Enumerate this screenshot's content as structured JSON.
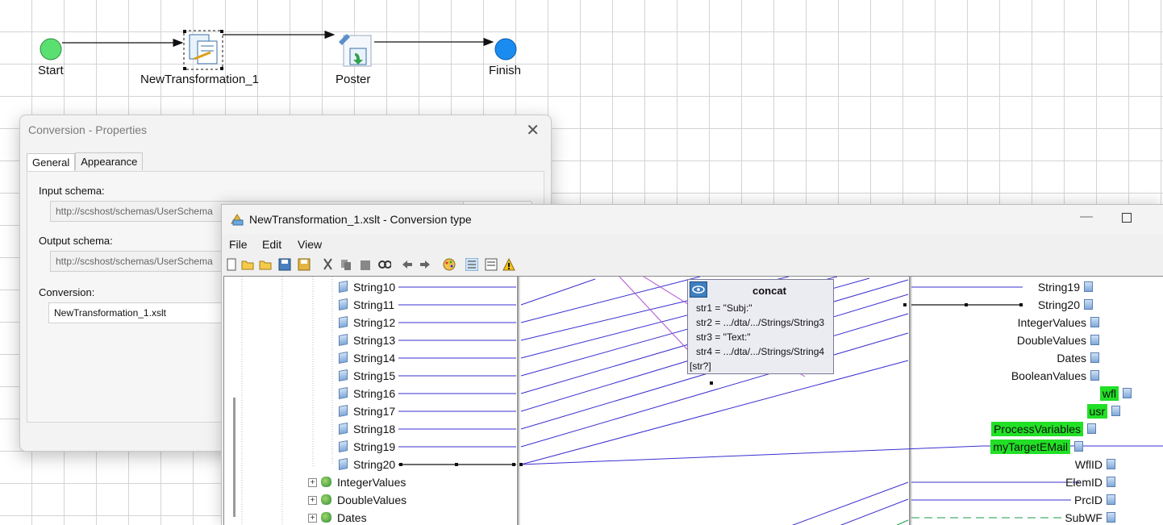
{
  "workflow": {
    "nodes": [
      {
        "label": "Start"
      },
      {
        "label": "NewTransformation_1"
      },
      {
        "label": "Poster"
      },
      {
        "label": "Finish"
      }
    ]
  },
  "properties_dialog": {
    "title": "Conversion - Properties",
    "close_glyph": "✕",
    "tabs": [
      "General",
      "Appearance"
    ],
    "input_schema_label": "Input schema:",
    "input_schema_value": "http://scshost/schemas/UserSchema",
    "output_schema_label": "Output schema:",
    "output_schema_value": "http://scshost/schemas/UserSchema",
    "conversion_label": "Conversion:",
    "conversion_value": "NewTransformation_1.xslt"
  },
  "conversion_window": {
    "title": "NewTransformation_1.xslt - Conversion type",
    "minimize_glyph": "—",
    "menu": [
      "File",
      "Edit",
      "View"
    ],
    "toolbar_icons": [
      "new-icon",
      "open-icon",
      "open-folder-icon",
      "save-icon",
      "save-all-icon",
      "cut-icon",
      "copy-icon",
      "paste-icon",
      "find-icon",
      "undo-icon",
      "redo-icon",
      "palette-icon",
      "view-tree-icon",
      "view-list-icon",
      "warning-icon"
    ],
    "left_tree": [
      "String10",
      "String11",
      "String12",
      "String13",
      "String14",
      "String15",
      "String16",
      "String17",
      "String18",
      "String19",
      "String20"
    ],
    "left_groups": [
      "IntegerValues",
      "DoubleValues",
      "Dates"
    ],
    "right_tree": [
      {
        "label": "String19",
        "highlight": false
      },
      {
        "label": "String20",
        "highlight": false
      },
      {
        "label": "IntegerValues",
        "highlight": false
      },
      {
        "label": "DoubleValues",
        "highlight": false
      },
      {
        "label": "Dates",
        "highlight": false
      },
      {
        "label": "BooleanValues",
        "highlight": false
      },
      {
        "label": "wfl",
        "highlight": true
      },
      {
        "label": "usr",
        "highlight": true
      },
      {
        "label": "ProcessVariables",
        "highlight": true
      },
      {
        "label": "myTargetEMail",
        "highlight": true
      },
      {
        "label": "WflID",
        "highlight": false
      },
      {
        "label": "ElemID",
        "highlight": false
      },
      {
        "label": "PrcID",
        "highlight": false
      },
      {
        "label": "SubWF",
        "highlight": false
      }
    ],
    "concat": {
      "title": "concat",
      "params": [
        "str1 = \"Subj:\"",
        "str2 = .../dta/.../Strings/String3",
        "str3 = \"Text:\"",
        "str4 = .../dta/.../Strings/String4"
      ],
      "footer": "[str?]"
    },
    "colors": {
      "link": "#3b2fd0",
      "highlight": "#22e026",
      "concat_link": "#b04fd0"
    }
  }
}
